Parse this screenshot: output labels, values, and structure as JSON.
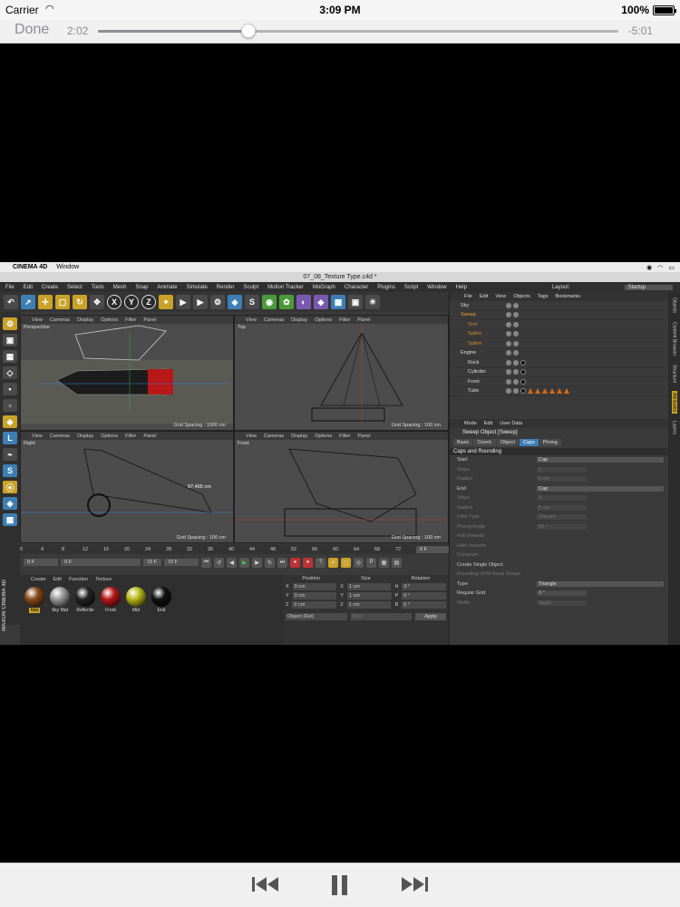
{
  "status_bar": {
    "carrier": "Carrier",
    "time": "3:09 PM",
    "battery": "100%"
  },
  "player": {
    "done_label": "Done",
    "elapsed": "2:02",
    "remaining": "-5:01",
    "progress": 0.29
  },
  "colors": {
    "accent": "#3d7fb5",
    "highlight": "#c9a227"
  },
  "controls": {
    "prev_icon": "rewind-icon",
    "pause_icon": "pause-icon",
    "next_icon": "fast-forward-icon"
  },
  "c4d": {
    "mac_menu": {
      "app": "CINEMA 4D",
      "window": "Window"
    },
    "doc_title": "07_08_Texture Type.c4d *",
    "menu_items": [
      "File",
      "Edit",
      "Create",
      "Select",
      "Tools",
      "Mesh",
      "Snap",
      "Animate",
      "Simulate",
      "Render",
      "Sculpt",
      "Motion Tracker",
      "MoGraph",
      "Character",
      "Plugins",
      "Script",
      "Window",
      "Help"
    ],
    "layout_label": "Layout:",
    "layout_value": "Startup",
    "viewport_menu": [
      "View",
      "Cameras",
      "Display",
      "Options",
      "Filter",
      "Panel"
    ],
    "viewports": [
      {
        "label": "Perspective",
        "grid": "Grid Spacing : 1000 cm"
      },
      {
        "label": "Top",
        "grid": "Grid Spacing : 100 cm"
      },
      {
        "label": "Right",
        "grid": "Grid Spacing : 100 cm",
        "measure": "97.465 cm"
      },
      {
        "label": "Front",
        "grid": "Grid Spacing : 100 cm"
      }
    ],
    "timeline_ticks": [
      "0",
      "4",
      "8",
      "12",
      "16",
      "20",
      "24",
      "28",
      "32",
      "36",
      "40",
      "44",
      "48",
      "52",
      "56",
      "60",
      "64",
      "68",
      "72"
    ],
    "timeline_end": "0 F",
    "transport": {
      "start": "0 F",
      "current": "0 F",
      "end_a": "72 F",
      "end_b": "72 F"
    },
    "material_menu": [
      "Create",
      "Edit",
      "Function",
      "Texture"
    ],
    "materials": [
      {
        "name": "Mat",
        "color": "#8a4a1a"
      },
      {
        "name": "Sky Mat",
        "color": "#9a9a9a"
      },
      {
        "name": "Reflectiv",
        "color": "#222"
      },
      {
        "name": "Front",
        "color": "#b81818"
      },
      {
        "name": "Mid",
        "color": "#b8b818"
      },
      {
        "name": "End",
        "color": "#111"
      }
    ],
    "coords": {
      "headers": [
        "Position",
        "Size",
        "Rotation"
      ],
      "rows": [
        {
          "a": "X",
          "pos": "0 cm",
          "b": "X",
          "size": "1 cm",
          "c": "H",
          "rot": "0 °"
        },
        {
          "a": "Y",
          "pos": "0 cm",
          "b": "Y",
          "size": "1 cm",
          "c": "P",
          "rot": "0 °"
        },
        {
          "a": "Z",
          "pos": "0 cm",
          "b": "Z",
          "size": "1 cm",
          "c": "B",
          "rot": "0 °"
        }
      ],
      "mode": "Object (Rel)",
      "size_mode": "Size",
      "apply": "Apply"
    },
    "objects_menu": [
      "File",
      "Edit",
      "View",
      "Objects",
      "Tags",
      "Bookmarks"
    ],
    "objects": [
      "Sky",
      "Sweep",
      "Text",
      "Spline",
      "Spline",
      "Engine",
      "Rock",
      "Cylinder",
      "Front",
      "Tube"
    ],
    "attr_menu": [
      "Mode",
      "Edit",
      "User Data"
    ],
    "attr_title": "Sweep Object [Sweep]",
    "attr_tabs": [
      "Basic",
      "Coord.",
      "Object",
      "Caps",
      "Phong"
    ],
    "attr_section": "Caps and Rounding",
    "attr_rows": [
      {
        "k": "Start",
        "v": "Cap",
        "wide": true
      },
      {
        "k": "Steps",
        "v": "1",
        "dim": true
      },
      {
        "k": "Radius",
        "v": "5 cm",
        "dim": true
      },
      {
        "k": "End",
        "v": "Cap",
        "wide": true
      },
      {
        "k": "Steps",
        "v": "1",
        "dim": true
      },
      {
        "k": "Radius",
        "v": "5 cm",
        "dim": true
      },
      {
        "k": "Fillet Type",
        "v": "Convex",
        "dim": true
      },
      {
        "k": "Phong Angle",
        "v": "60 °",
        "dim": true
      },
      {
        "k": "Hull Inwards",
        "v": "",
        "dim": true
      },
      {
        "k": "Hole Inwards",
        "v": "",
        "dim": true
      },
      {
        "k": "Constrain",
        "v": "",
        "dim": true
      },
      {
        "k": "Create Single Object",
        "v": ""
      },
      {
        "k": "Rounding UVW Keep Shape",
        "v": "",
        "dim": true
      },
      {
        "k": "Type",
        "v": "Triangle",
        "wide": true
      },
      {
        "k": "Regular Grid",
        "v": "0 °"
      },
      {
        "k": "Width",
        "v": "Apply",
        "dim": true
      }
    ],
    "side_tabs": [
      "Objects",
      "Content Browser",
      "Structure",
      "Attributes",
      "Layers"
    ],
    "maxon": "MAXON CINEMA 4D"
  }
}
